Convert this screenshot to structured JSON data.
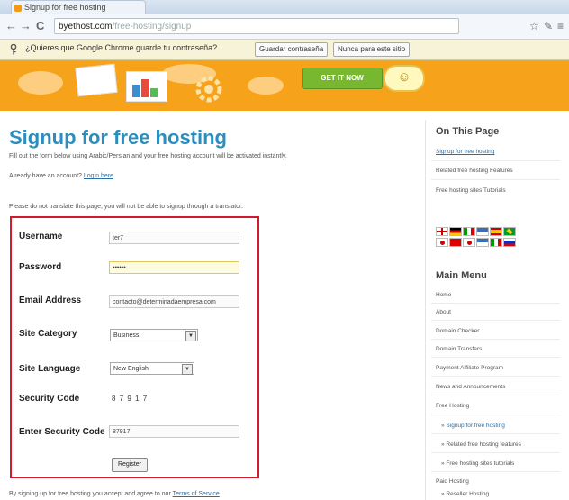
{
  "browser": {
    "tab_title": "Signup for free hosting",
    "url_host": "byethost.com",
    "url_rest": "/free-hosting/signup",
    "nav": {
      "back": "←",
      "forward": "→",
      "reload": "C"
    },
    "toolbar_icons": {
      "star": "☆",
      "wrench": "✎",
      "menu": "≡"
    },
    "infobar": {
      "prompt": "¿Quieres que Google Chrome guarde tu contraseña?",
      "save_label": "Guardar contraseña",
      "never_label": "Nunca para este sitio"
    }
  },
  "banner": {
    "cta_label": "GET IT NOW",
    "smiley": "☺"
  },
  "main": {
    "title": "Signup for free hosting",
    "intro": "Fill out the form below using Arabic/Persian and your free hosting account will be activated instantly.",
    "account_prefix": "Already have an account? ",
    "account_link": "Login here",
    "notice": "Please do not translate this page, you will not be able to signup through a translator.",
    "footer_prefix": "By signing up for free hosting you accept and agree to our ",
    "footer_link": "Terms of Service"
  },
  "form": {
    "username_label": "Username",
    "username_value": "ter7",
    "password_label": "Password",
    "password_value": "••••••",
    "email_label": "Email Address",
    "email_value": "contacto@determinadaempresa.com",
    "category_label": "Site Category",
    "category_value": "Business",
    "language_label": "Site Language",
    "language_value": "New English",
    "security_label": "Security Code",
    "security_value": "8 7 9 1 7",
    "enter_security_label": "Enter Security Code",
    "enter_security_value": "87917",
    "register_label": "Register"
  },
  "sidebar": {
    "on_this_page_title": "On This Page",
    "on_this_page": [
      "Signup for free hosting",
      "Related free hosting Features",
      "Free hosting sites Tutorials"
    ],
    "main_menu_title": "Main Menu",
    "menu": [
      "Home",
      "About",
      "Domain Checker",
      "Domain Transfers",
      "Payment Affiliate Program",
      "News and Announcements",
      "Free Hosting",
      "» Signup for free hosting",
      "» Related free hosting features",
      "» Free hosting sites tutorials",
      "Paid Hosting",
      "» Reseller Hosting"
    ]
  },
  "colors": {
    "title_blue": "#2a8fc0",
    "form_border_red": "#d11b2b",
    "banner_orange": "#f7a21b",
    "cta_green": "#78b830"
  }
}
